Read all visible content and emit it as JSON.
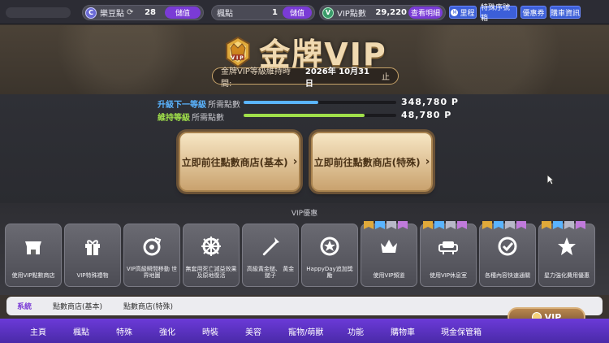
{
  "topbar": {
    "bean": {
      "label": "樂豆點",
      "value": "28",
      "button": "儲值"
    },
    "maple": {
      "label": "楓點",
      "value": "1",
      "button": "儲值"
    },
    "vip": {
      "label": "VIP點數",
      "value": "29,220",
      "button": "查看明細"
    },
    "buttons": [
      "里程",
      "特殊序號箱",
      "優惠券",
      "購車資訊"
    ]
  },
  "hero": {
    "title": "金牌VIP",
    "maintain_label": "金牌VIP等級維持時間:",
    "maintain_date": "2026年 10月31日",
    "maintain_end": "止"
  },
  "progress": [
    {
      "key": "升級下一等級",
      "suffix": "所需點數",
      "color": "#5ab4ff",
      "fill_ratio": 0.49,
      "points": "348,780 P"
    },
    {
      "key": "維持等級",
      "suffix": "所需點數",
      "color": "#a0e04a",
      "fill_ratio": 0.79,
      "points": "48,780 P"
    }
  ],
  "shop_buttons": [
    {
      "label": "立即前往點數商店(基本)"
    },
    {
      "label": "立即前往點數商店(特殊)"
    }
  ],
  "benefits": {
    "title": "VIP優惠",
    "items": [
      {
        "label": "使用VIP點數商店",
        "icon": "store-icon",
        "flags": false
      },
      {
        "label": "VIP特殊禮物",
        "icon": "gift-icon",
        "flags": false
      },
      {
        "label": "VIP高級瞬間移動 世界地圖",
        "icon": "teleport-icon",
        "flags": false
      },
      {
        "label": "無套用死亡減益效果 及原地復活",
        "icon": "wheel-icon",
        "flags": false
      },
      {
        "label": "高級黃金鎚、 黃金鎚子",
        "icon": "shovel-icon",
        "flags": false
      },
      {
        "label": "HappyDay追加獎勵",
        "icon": "badge-icon",
        "flags": false
      },
      {
        "label": "使用VIP頻道",
        "icon": "crown-icon",
        "flags": true
      },
      {
        "label": "使用VIP休息室",
        "icon": "sofa-icon",
        "flags": true
      },
      {
        "label": "各種內容快速通關",
        "icon": "check-icon",
        "flags": true
      },
      {
        "label": "星力強化費用優惠",
        "icon": "star-icon",
        "flags": true
      }
    ]
  },
  "tabs": [
    {
      "label": "系統",
      "active": true
    },
    {
      "label": "點數商店(基本)",
      "active": false
    },
    {
      "label": "點數商店(特殊)",
      "active": false
    }
  ],
  "vip_button": "VIP",
  "nav": [
    "主頁",
    "楓點",
    "特殊",
    "強化",
    "時裝",
    "美容",
    "寵物/萌獸",
    "功能",
    "購物車",
    "現金保管箱"
  ]
}
